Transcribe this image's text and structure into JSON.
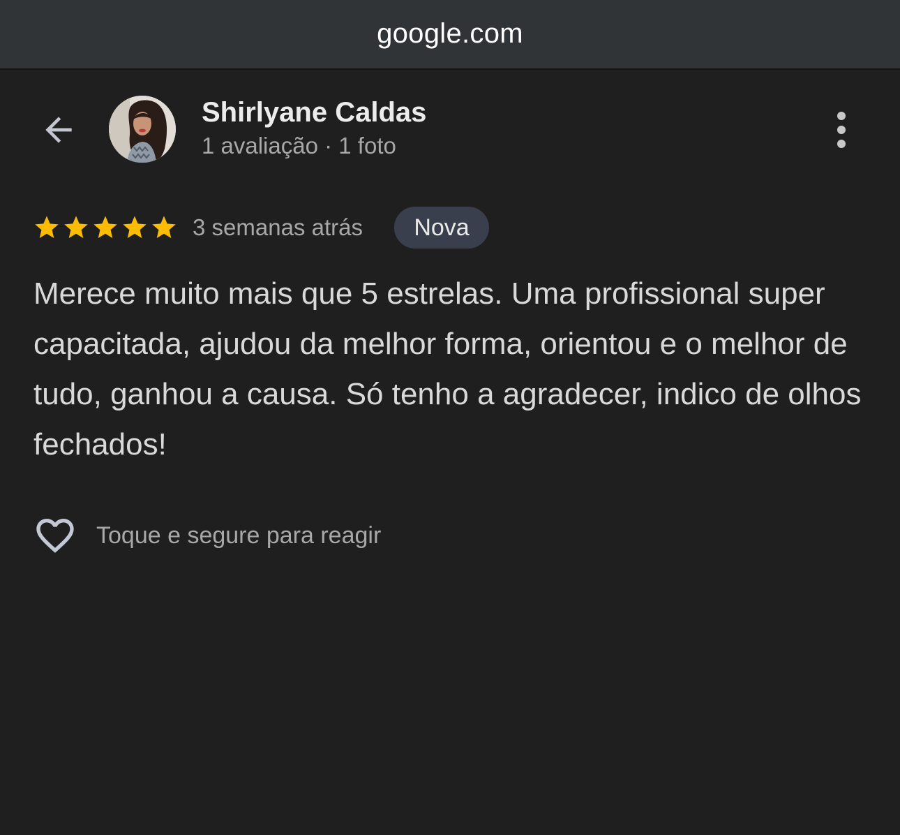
{
  "browser": {
    "url": "google.com"
  },
  "header": {
    "back_icon": "arrow-back-icon",
    "reviewer_name": "Shirlyane Caldas",
    "reviewer_meta": "1 avaliação · 1 foto",
    "more_icon": "more-vert-icon"
  },
  "review": {
    "rating": 5,
    "rating_max": 5,
    "star_color": "#fbbc04",
    "time_ago": "3 semanas atrás",
    "badge": "Nova",
    "text": "Merece muito mais que 5 estrelas. Uma profissional super capacitada, ajudou da melhor forma, orientou e o melhor de tudo, ganhou a causa. Só tenho a agradecer, indico de olhos fechados!"
  },
  "reaction": {
    "icon": "heart-outline-icon",
    "hint": "Toque e segure para reagir"
  }
}
